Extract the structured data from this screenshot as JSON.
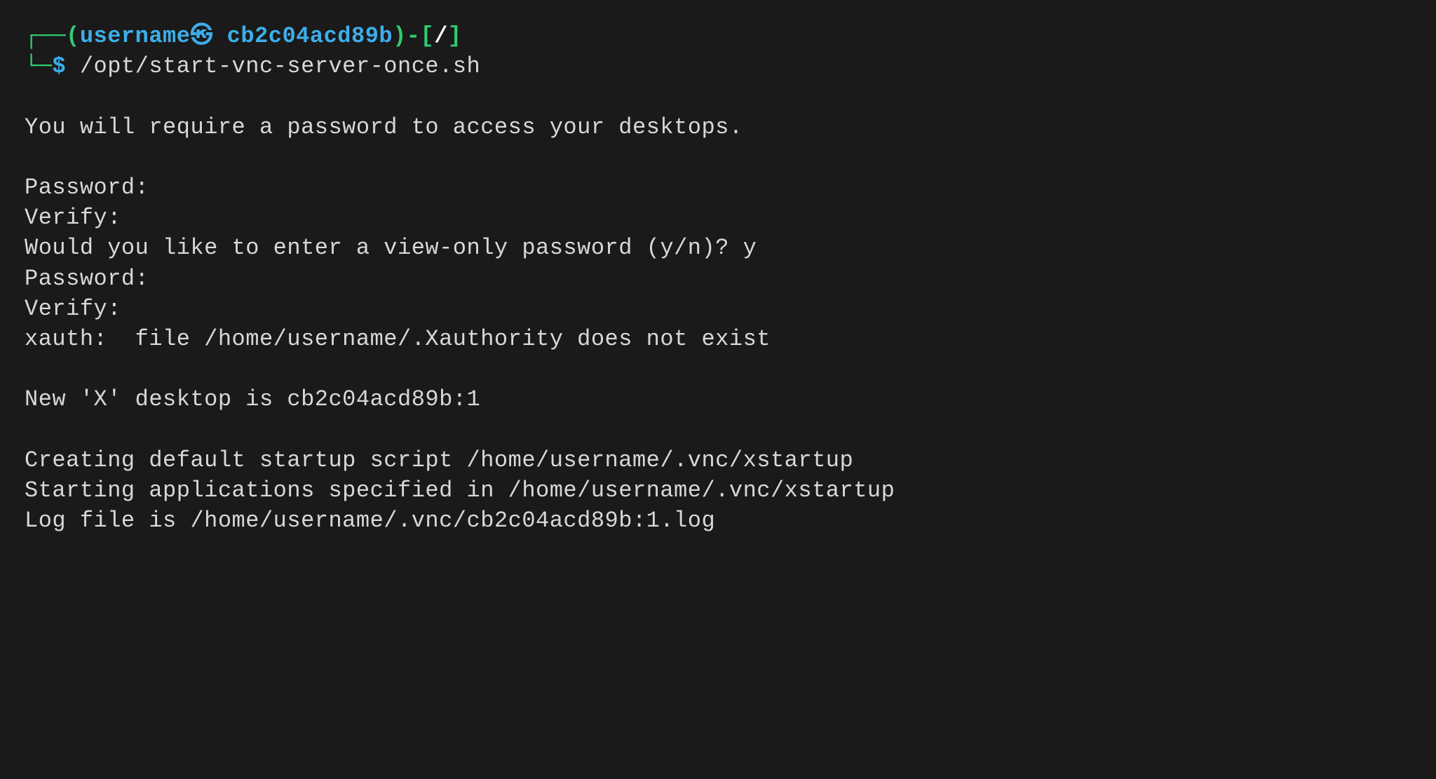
{
  "prompt": {
    "box_top": "┌──",
    "paren_open": "(",
    "username": "username",
    "at_symbol": "㉿",
    "hostname": "cb2c04acd89b",
    "paren_close": ")",
    "dash": "-",
    "bracket_open": "[",
    "cwd": "/",
    "bracket_close": "]",
    "box_bottom": "└─",
    "dollar": "$",
    "command": "/opt/start-vnc-server-once.sh"
  },
  "output": {
    "line1": "You will require a password to access your desktops.",
    "line2": "Password:",
    "line3": "Verify:",
    "line4": "Would you like to enter a view-only password (y/n)? y",
    "line5": "Password:",
    "line6": "Verify:",
    "line7": "xauth:  file /home/username/.Xauthority does not exist",
    "line8": "New 'X' desktop is cb2c04acd89b:1",
    "line9": "Creating default startup script /home/username/.vnc/xstartup",
    "line10": "Starting applications specified in /home/username/.vnc/xstartup",
    "line11": "Log file is /home/username/.vnc/cb2c04acd89b:1.log"
  }
}
